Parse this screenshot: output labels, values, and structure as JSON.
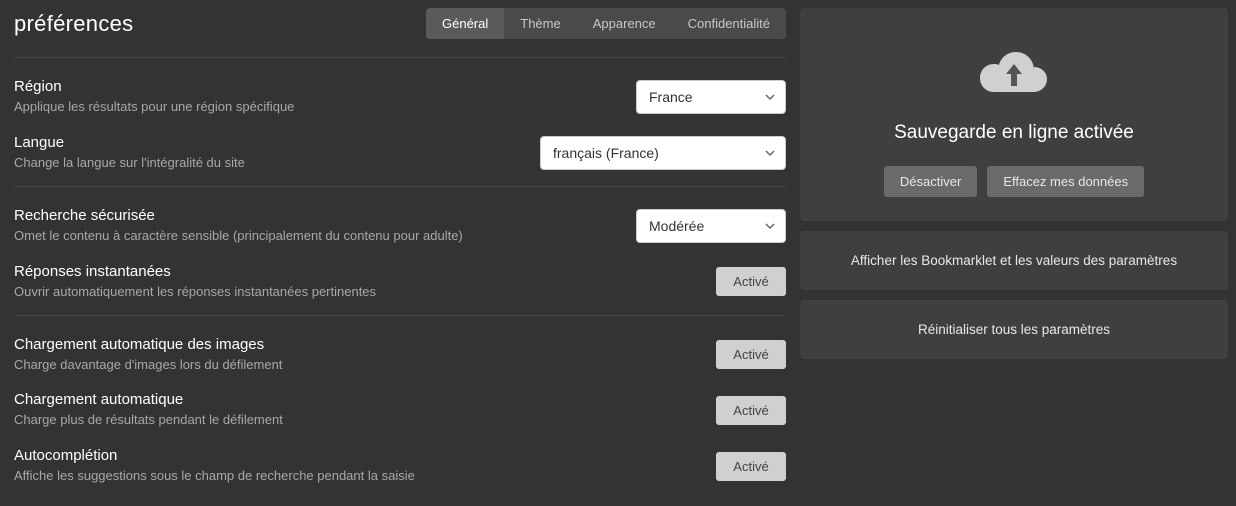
{
  "page_title": "préférences",
  "tabs": {
    "general": "Général",
    "theme": "Thème",
    "appearance": "Apparence",
    "privacy": "Confidentialité"
  },
  "settings": {
    "region": {
      "title": "Région",
      "desc": "Applique les résultats pour une région spécifique",
      "value": "France"
    },
    "language": {
      "title": "Langue",
      "desc": "Change la langue sur l'intégralité du site",
      "value": "français (France)"
    },
    "safesearch": {
      "title": "Recherche sécurisée",
      "desc": "Omet le contenu à caractère sensible (principalement du contenu pour adulte)",
      "value": "Modérée"
    },
    "instant": {
      "title": "Réponses instantanées",
      "desc": "Ouvrir automatiquement les réponses instantanées pertinentes",
      "value": "Activé"
    },
    "autoimg": {
      "title": "Chargement automatique des images",
      "desc": "Charge davantage d'images lors du défilement",
      "value": "Activé"
    },
    "autoload": {
      "title": "Chargement automatique",
      "desc": "Charge plus de résultats pendant le défilement",
      "value": "Activé"
    },
    "autocomplete": {
      "title": "Autocomplétion",
      "desc": "Affiche les suggestions sous le champ de recherche pendant la saisie",
      "value": "Activé"
    }
  },
  "sidebar": {
    "cloud_title": "Sauvegarde en ligne activée",
    "disable": "Désactiver",
    "erase": "Effacez mes données",
    "bookmarklet": "Afficher les Bookmarklet et les valeurs des paramètres",
    "reset": "Réinitialiser tous les paramètres"
  }
}
